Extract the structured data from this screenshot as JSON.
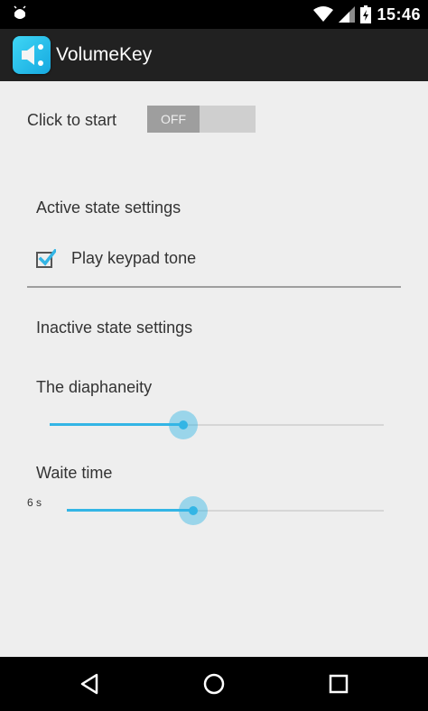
{
  "status_bar": {
    "time": "15:46",
    "icons": [
      "android-debug-icon",
      "wifi-icon",
      "signal-icon",
      "battery-icon"
    ]
  },
  "app": {
    "title": "VolumeKey",
    "icon": "volume-key-app-icon"
  },
  "main": {
    "start_label": "Click to start",
    "toggle_state": "OFF",
    "active_section_title": "Active state settings",
    "keypad_tone_label": "Play keypad tone",
    "keypad_tone_checked": true,
    "inactive_section_title": "Inactive state settings",
    "diaphaneity_label": "The diaphaneity",
    "diaphaneity_value": 0.4,
    "wait_time_label": "Waite time",
    "wait_time_value_text": "6 s",
    "wait_time_value": 0.4
  },
  "nav_bar": {
    "buttons": [
      "back-icon",
      "home-icon",
      "recents-icon"
    ]
  },
  "colors": {
    "accent": "#33b5e5",
    "background": "#eeeeee",
    "action_bar": "#212121"
  }
}
